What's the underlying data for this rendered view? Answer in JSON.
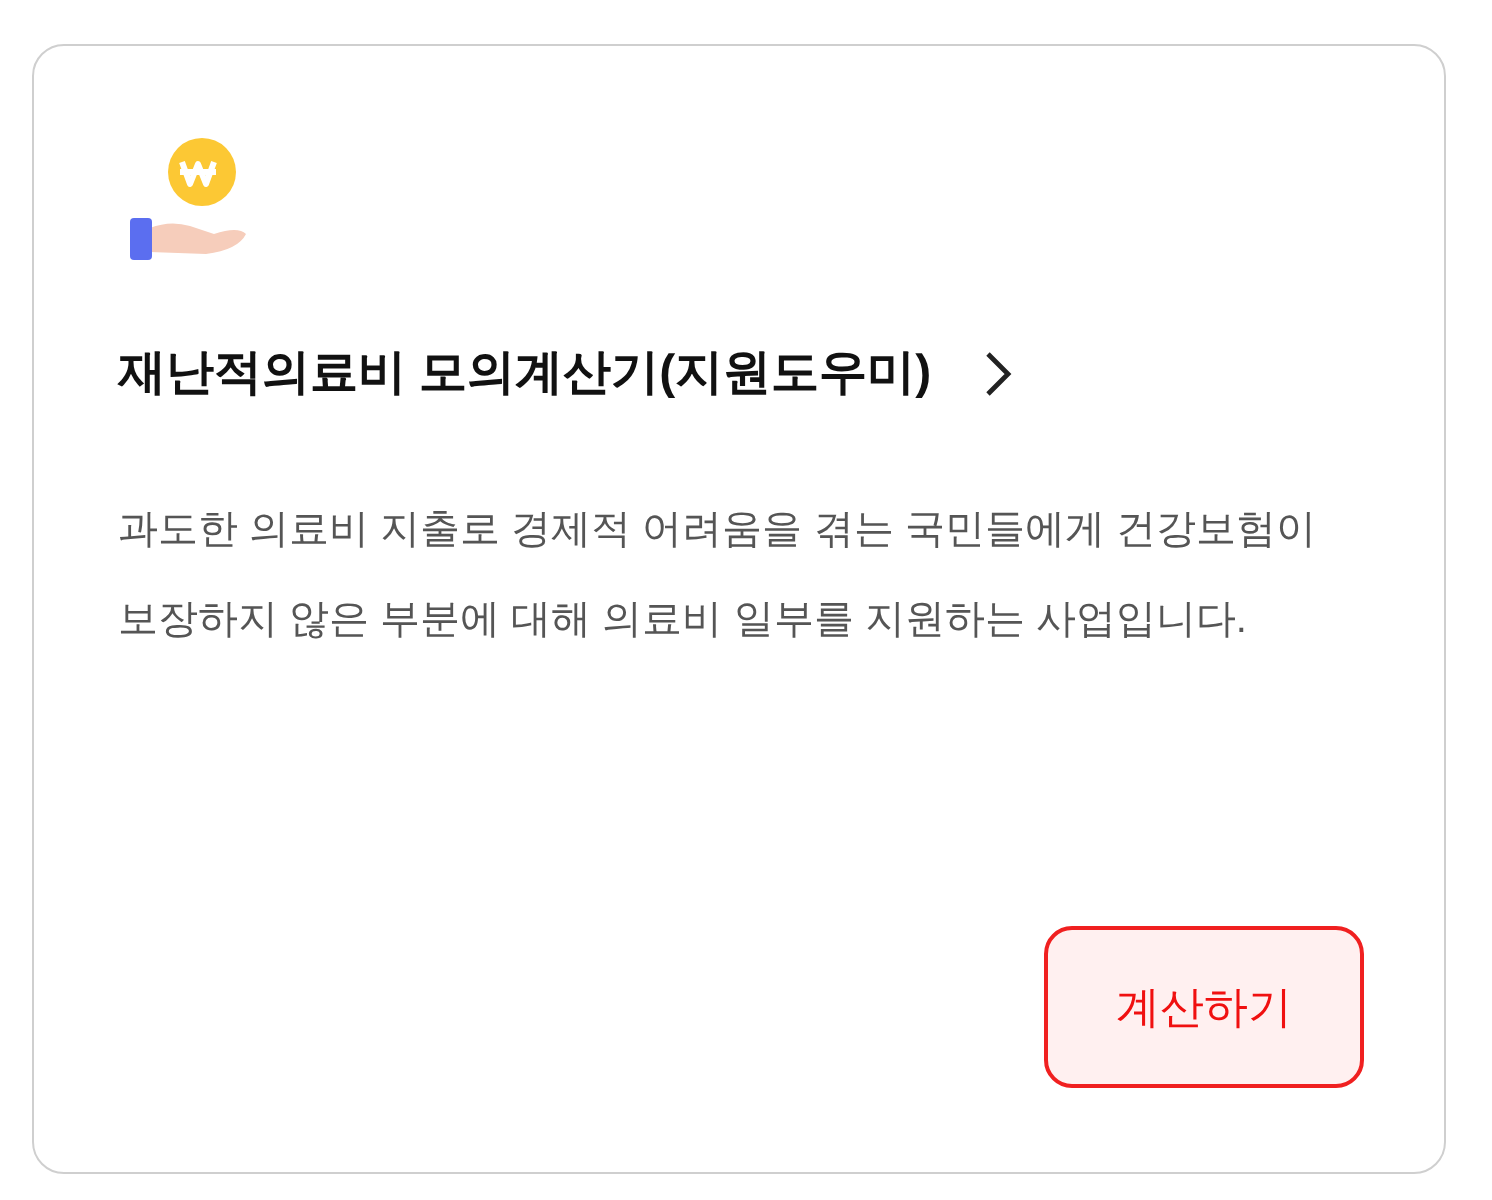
{
  "card": {
    "title": "재난적의료비 모의계산기(지원도우미)",
    "description": "과도한 의료비 지출로 경제적 어려움을 겪는 국민들에게 건강보험이 보장하지 않은 부분에 대해 의료비 일부를 지원하는 사업입니다.",
    "button": "계산하기"
  }
}
